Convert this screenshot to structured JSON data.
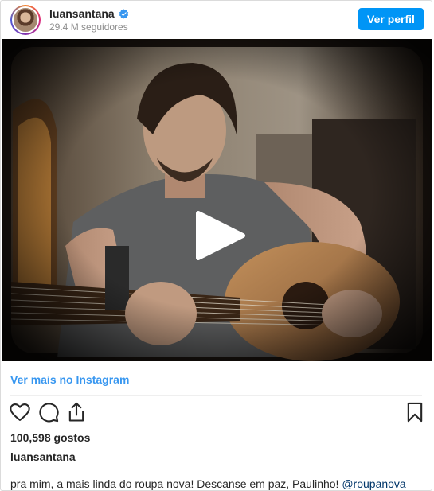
{
  "header": {
    "username": "luansantana",
    "followers": "29.4 M seguidores",
    "view_profile_label": "Ver perfil"
  },
  "media": {
    "type": "video"
  },
  "links": {
    "view_more": "Ver mais no Instagram"
  },
  "actions": {
    "icons": [
      "heart-icon",
      "comment-icon",
      "share-icon",
      "bookmark-icon"
    ]
  },
  "likes": "100,598 gostos",
  "author": "luansantana",
  "caption": {
    "text": "pra mim, a mais linda do roupa nova! Descanse em paz, Paulinho! ",
    "mention": "@roupanova"
  },
  "colors": {
    "accent": "#0095f6",
    "link": "#3897f0",
    "mention": "#003569",
    "verified": "#3897f0"
  }
}
